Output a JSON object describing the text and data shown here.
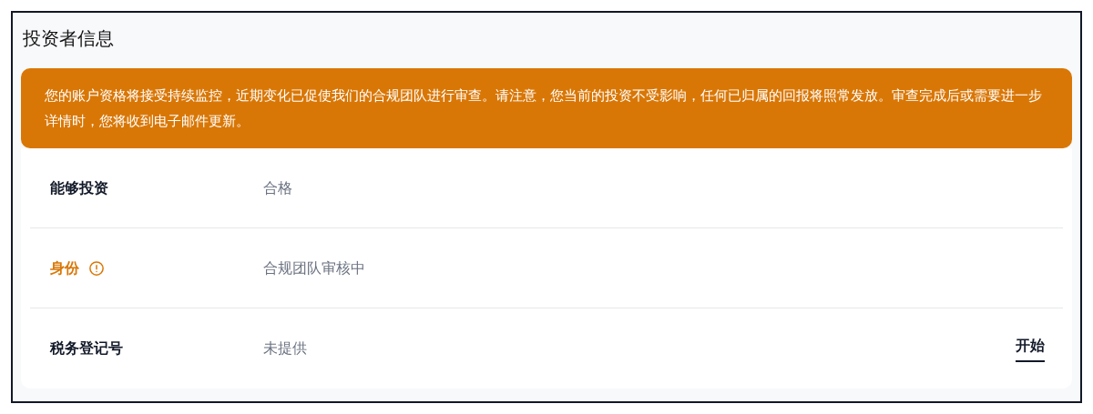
{
  "title": "投资者信息",
  "notice": "您的账户资格将接受持续监控，近期变化已促使我们的合规团队进行审查。请注意，您当前的投资不受影响，任何已归属的回报将照常发放。审查完成后或需要进一步详情时，您将收到电子邮件更新。",
  "rows": [
    {
      "label": "能够投资",
      "value": "合格",
      "warning": false
    },
    {
      "label": "身份",
      "value": "合规团队审核中",
      "warning": true
    },
    {
      "label": "税务登记号",
      "value": "未提供",
      "warning": false,
      "action": "开始"
    }
  ]
}
